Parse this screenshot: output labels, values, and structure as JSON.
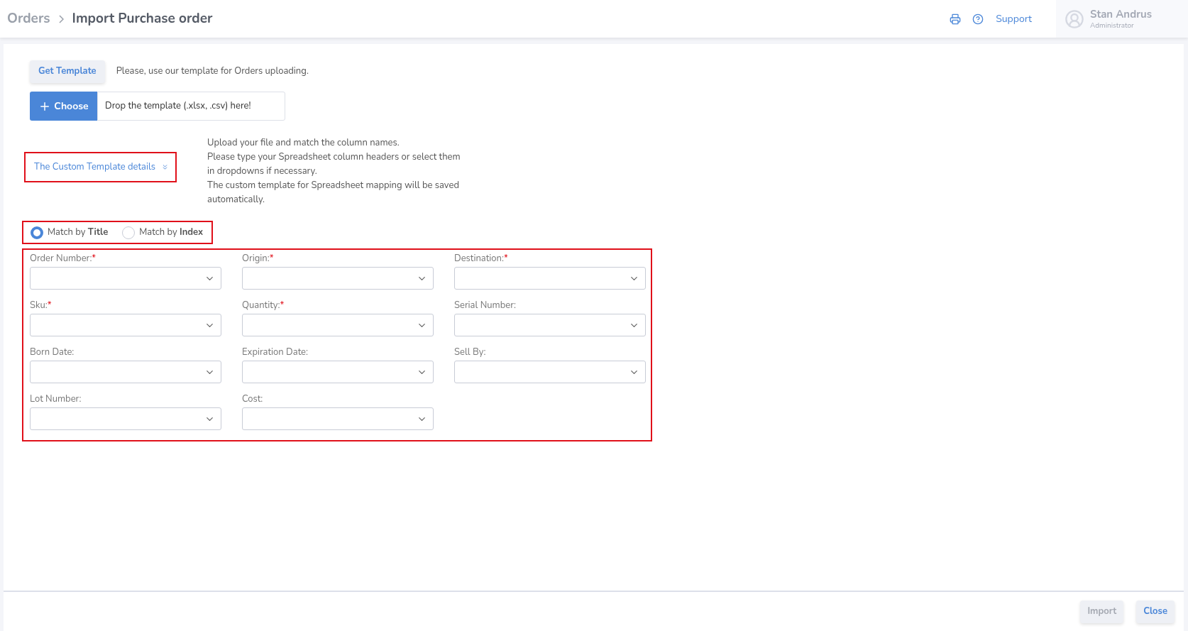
{
  "breadcrumb": {
    "parent": "Orders",
    "current": "Import Purchase order"
  },
  "header": {
    "support": "Support",
    "user": {
      "name": "Stan Andrus",
      "role": "Administrator"
    }
  },
  "template": {
    "button": "Get Template",
    "hint": "Please, use our template for Orders uploading."
  },
  "upload": {
    "button": "Choose",
    "placeholder": "Drop the template (.xlsx, .csv) here!"
  },
  "details_link": {
    "label": "The Custom Template details",
    "expanded": false
  },
  "instructions": [
    "Upload your file and match the column names.",
    "Please type your Spreadsheet column headers or select them in dropdowns if necessary.",
    "The custom template for Spreadsheet mapping will be saved automatically."
  ],
  "match_options": [
    {
      "label": "Match by **Title**",
      "selected": true
    },
    {
      "label": "Match by **Index**",
      "selected": false
    }
  ],
  "fields": [
    {
      "label": "Order Number:",
      "required_mark": "*"
    },
    {
      "label": "Origin:",
      "required_mark": "*"
    },
    {
      "label": "Destination:",
      "required_mark": "*"
    },
    {
      "label": "Sku:",
      "required_mark": "*"
    },
    {
      "label": "Quantity:",
      "required_mark": "*"
    },
    {
      "label": "Serial Number:"
    },
    {
      "label": "Born Date:"
    },
    {
      "label": "Expiration Date:"
    },
    {
      "label": "Sell By:"
    },
    {
      "label": "Lot Number:"
    },
    {
      "label": "Cost:"
    }
  ],
  "footer": [
    {
      "label": "Import",
      "disabled": true
    },
    {
      "label": "Close",
      "disabled": false
    }
  ]
}
